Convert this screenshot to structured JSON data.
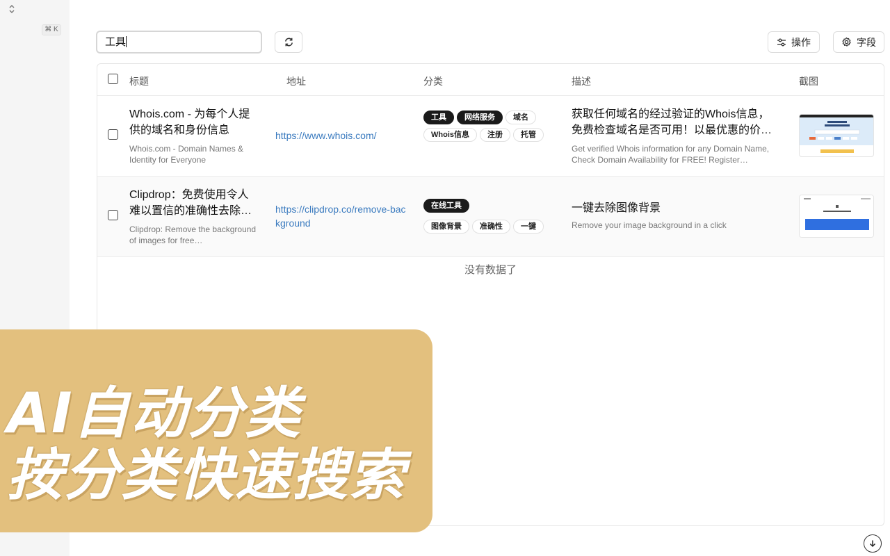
{
  "sidebar": {
    "shortcut": "⌘ K",
    "toggle_icon": "chevron-updown-icon"
  },
  "toolbar": {
    "search_value": "工具",
    "refresh_icon": "refresh-icon",
    "operations_label": "操作",
    "operations_icon": "sliders-icon",
    "fields_label": "字段",
    "fields_icon": "gear-icon"
  },
  "table": {
    "columns": [
      "标题",
      "地址",
      "分类",
      "描述",
      "截图"
    ],
    "rows": [
      {
        "title": "Whois.com - 为每个人提供的域名和身份信息",
        "subtitle": "Whois.com - Domain Names & Identity for Everyone",
        "url": "https://www.whois.com/",
        "tags": [
          {
            "label": "工具",
            "style": "dark"
          },
          {
            "label": "网络服务",
            "style": "dark"
          },
          {
            "label": "域名",
            "style": "light"
          },
          {
            "label": "Whois信息",
            "style": "light"
          },
          {
            "label": "注册",
            "style": "light"
          },
          {
            "label": "托管",
            "style": "light"
          }
        ],
        "description": "获取任何域名的经过验证的Whois信息，免费检查域名是否可用！以最优惠的价格注…",
        "description_sub": "Get verified Whois information for any Domain Name, Check Domain Availability for FREE! Register Domain…"
      },
      {
        "title": "Clipdrop：免费使用令人难以置信的准确性去除图…",
        "subtitle": "Clipdrop: Remove the background of images for free…",
        "url": "https://clipdrop.co/remove-background",
        "tags": [
          {
            "label": "在线工具",
            "style": "dark"
          },
          {
            "label": "图像背景",
            "style": "light"
          },
          {
            "label": "准确性",
            "style": "light"
          },
          {
            "label": "一键",
            "style": "light"
          }
        ],
        "description": "一键去除图像背景",
        "description_sub": "Remove your image background in a click"
      }
    ],
    "empty_message": "没有数据了"
  },
  "banner": {
    "line1": "AI自动分类",
    "line2": "按分类快速搜索"
  },
  "footer": {
    "download_icon": "arrow-down-circle-icon"
  }
}
